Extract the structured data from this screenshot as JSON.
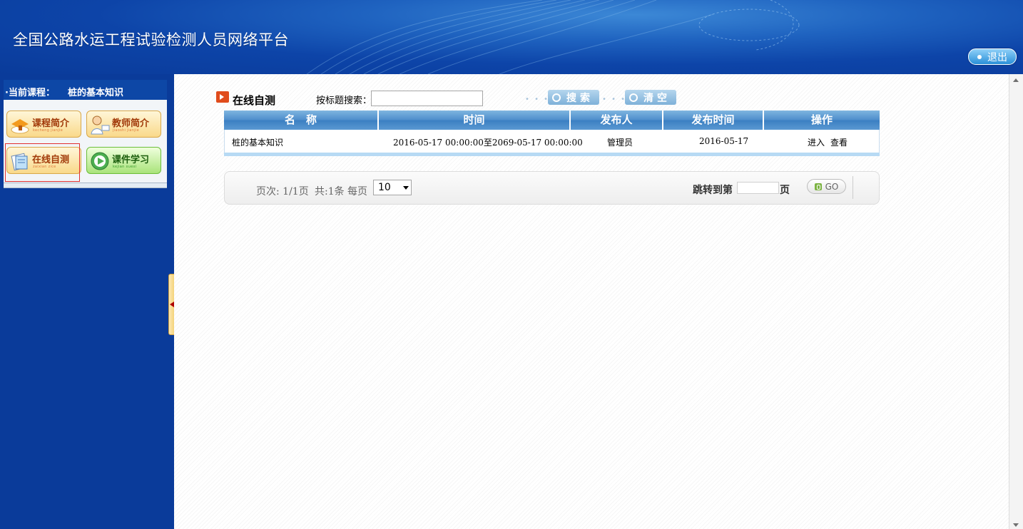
{
  "header": {
    "site_title": "全国公路水运工程试验检测人员网络平台",
    "logout_label": "退出"
  },
  "sidebar": {
    "current_course_label": "·当前课程：",
    "current_course_value": "桩的基本知识",
    "menu": [
      {
        "label": "课程简介",
        "sub": "kecheng jianjie",
        "style": "orange",
        "icon": "course-hat-icon"
      },
      {
        "label": "教师简介",
        "sub": "jiaoshi jianjie",
        "style": "orange",
        "icon": "teacher-icon"
      },
      {
        "label": "在线自测",
        "sub": "zaixian zice",
        "style": "orange",
        "icon": "exam-icon"
      },
      {
        "label": "课件学习",
        "sub": "kejian xuexi",
        "style": "green",
        "icon": "play-icon"
      }
    ],
    "selected": "在线自测"
  },
  "main": {
    "section_title": "在线自测",
    "search_label": "按标题搜索：",
    "search_value": "",
    "search_button": "搜索",
    "clear_button": "清空",
    "table": {
      "columns": [
        "名　称",
        "时间",
        "发布人",
        "发布时间",
        "操作"
      ],
      "rows": [
        {
          "name": "桩的基本知识",
          "time": "2016-05-17 00:00:00至2069-05-17 00:00:00",
          "publisher": "管理员",
          "publish_date": "2016-05-17",
          "actions": [
            "进入",
            "查看"
          ]
        }
      ]
    },
    "pager": {
      "page_info": "页次: 1/1页",
      "total": "共:1条",
      "per_page_label": "每页",
      "per_page_value": "10",
      "jump_prefix": "跳转到第",
      "jump_suffix": "页",
      "go_label": "GO"
    }
  },
  "colors": {
    "header_blue": "#0a3b9a",
    "table_head_blue": "#4f8fcc",
    "accent_orange": "#e04c1c"
  }
}
